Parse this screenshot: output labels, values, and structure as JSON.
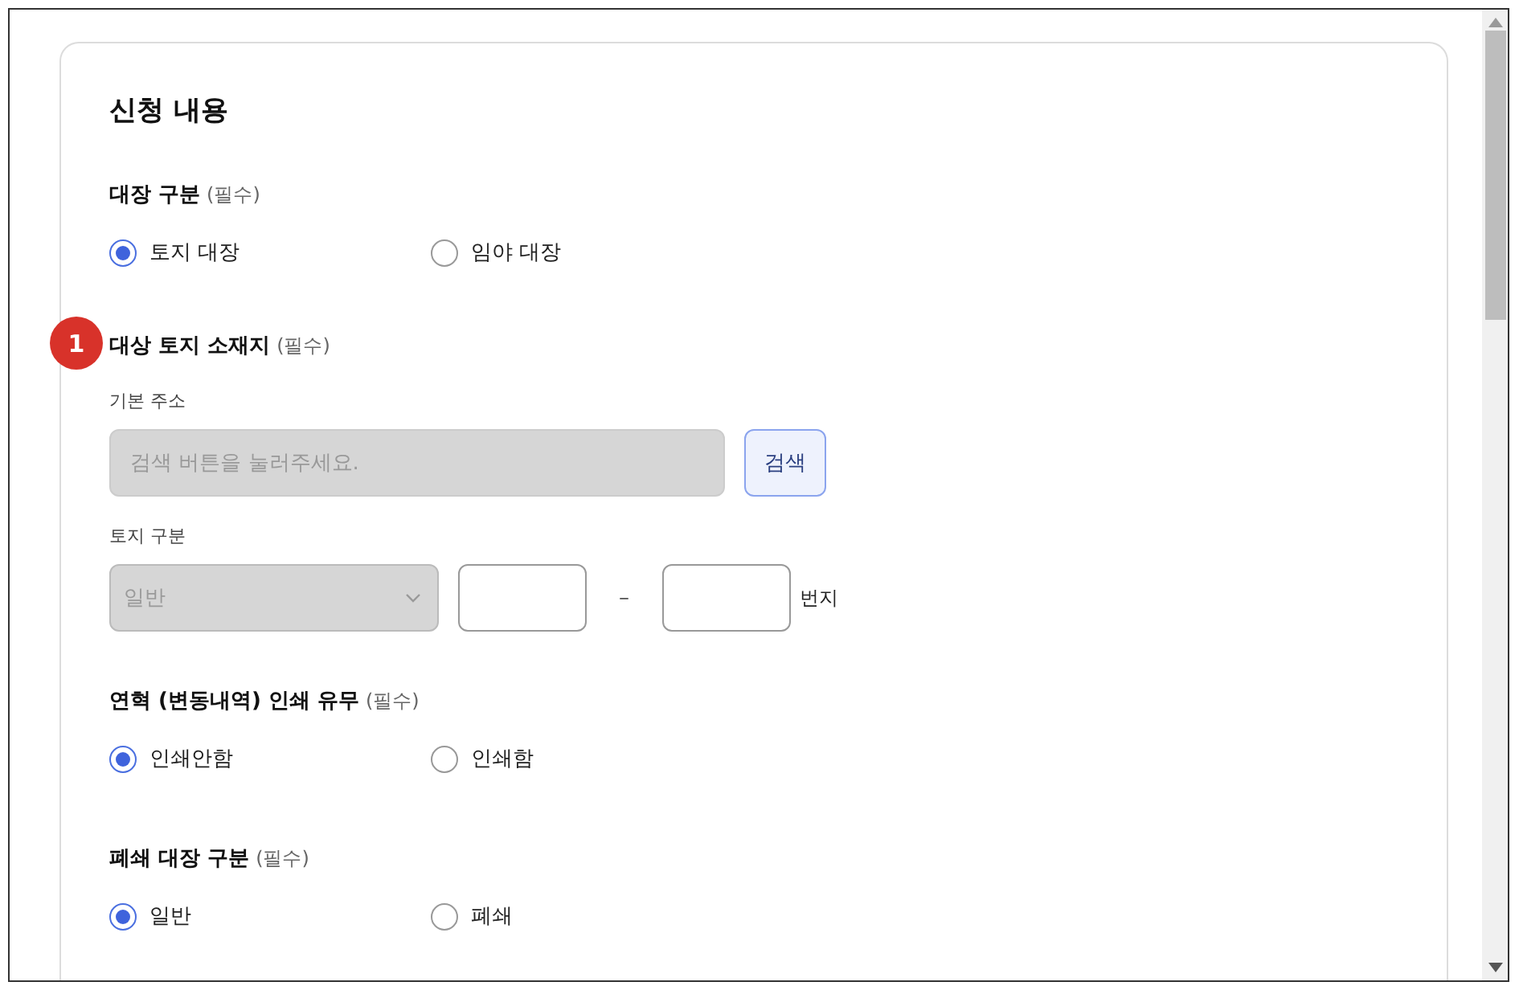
{
  "title": "신청 내용",
  "sections": [
    {
      "kind": "radio",
      "label": "대장 구분",
      "required": "(필수)",
      "options": [
        {
          "label": "토지 대장",
          "selected": true
        },
        {
          "label": "임야 대장",
          "selected": false
        }
      ]
    },
    {
      "kind": "address",
      "badge": "1",
      "label": "대상 토지 소재지",
      "required": "(필수)",
      "base_address": {
        "label": "기본 주소",
        "placeholder": "검색 버튼을 눌러주세요.",
        "disabled": true,
        "button": "검색"
      },
      "land_type": {
        "label": "토지 구분",
        "select_value": "일반",
        "disabled": true,
        "separator": "–",
        "unit": "번지"
      }
    },
    {
      "kind": "radio",
      "label": "연혁 (변동내역) 인쇄 유무",
      "required": "(필수)",
      "options": [
        {
          "label": "인쇄안함",
          "selected": true
        },
        {
          "label": "인쇄함",
          "selected": false
        }
      ]
    },
    {
      "kind": "radio",
      "label": "폐쇄 대장 구분",
      "required": "(필수)",
      "options": [
        {
          "label": "일반",
          "selected": true
        },
        {
          "label": "폐쇄",
          "selected": false
        }
      ]
    }
  ]
}
